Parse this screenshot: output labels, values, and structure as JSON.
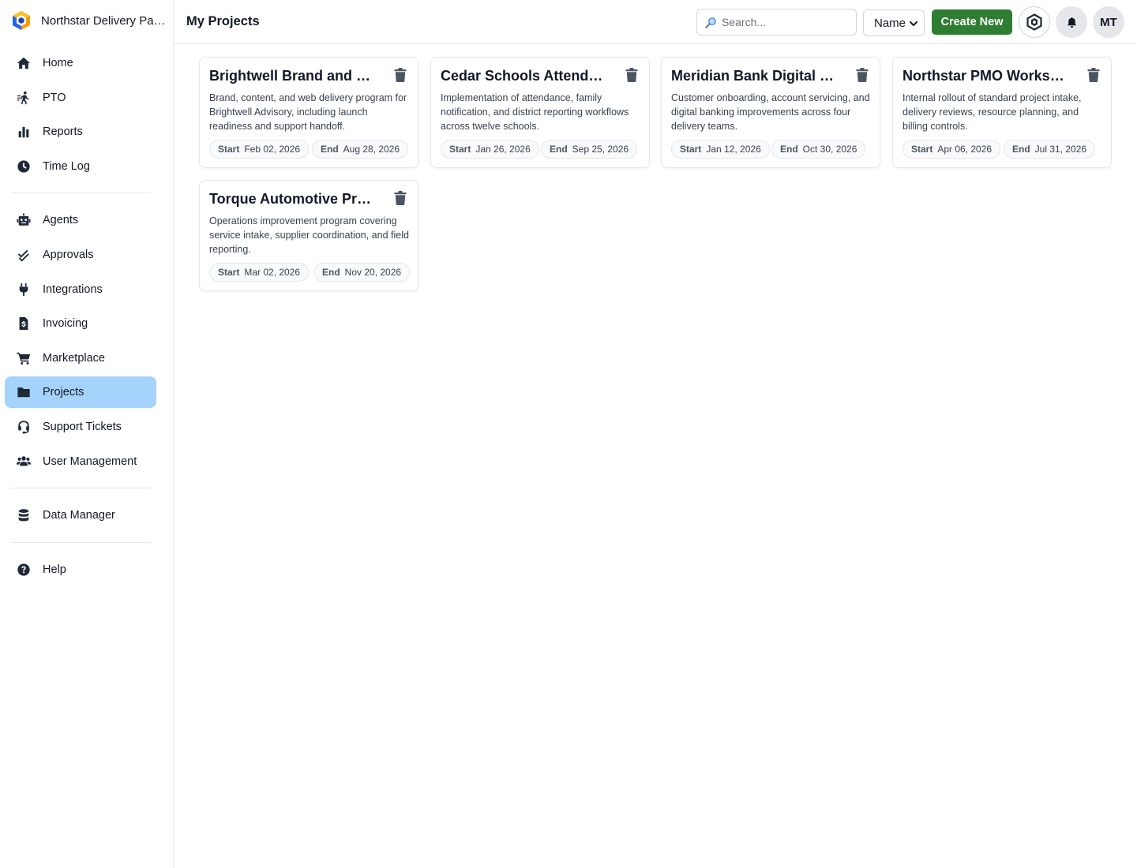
{
  "sidebar": {
    "org_name": "Northstar Delivery Partners",
    "items": [
      {
        "label": "Home",
        "icon": "home-icon"
      },
      {
        "label": "PTO",
        "icon": "walking-icon"
      },
      {
        "label": "Reports",
        "icon": "bar-chart-icon"
      },
      {
        "label": "Time Log",
        "icon": "clock-icon"
      },
      {
        "label": "Agents",
        "icon": "robot-icon"
      },
      {
        "label": "Approvals",
        "icon": "double-check-icon"
      },
      {
        "label": "Integrations",
        "icon": "plug-icon"
      },
      {
        "label": "Invoicing",
        "icon": "invoice-icon"
      },
      {
        "label": "Marketplace",
        "icon": "cart-icon"
      },
      {
        "label": "Projects",
        "icon": "folder-icon",
        "active": true
      },
      {
        "label": "Support Tickets",
        "icon": "headset-icon"
      },
      {
        "label": "User Management",
        "icon": "users-icon"
      },
      {
        "label": "Data Manager",
        "icon": "database-icon"
      },
      {
        "label": "Help",
        "icon": "question-icon"
      }
    ]
  },
  "header": {
    "title": "My Projects",
    "search_placeholder": "Search...",
    "sort_value": "Name",
    "create_label": "Create New",
    "avatar_initials": "MT"
  },
  "projects": [
    {
      "title": "Brightwell Brand and Web Launch",
      "description": "Brand, content, and web delivery program for Brightwell Advisory, including launch readiness and support handoff.",
      "start_label": "Start",
      "start": "Feb 02, 2026",
      "end_label": "End",
      "end": "Aug 28, 2026"
    },
    {
      "title": "Cedar Schools Attendance Platform",
      "description": "Implementation of attendance, family notification, and district reporting workflows across twelve schools.",
      "start_label": "Start",
      "start": "Jan 26, 2026",
      "end_label": "End",
      "end": "Sep 25, 2026"
    },
    {
      "title": "Meridian Bank Digital Onboarding",
      "description": "Customer onboarding, account servicing, and digital banking improvements across four delivery teams.",
      "start_label": "Start",
      "start": "Jan 12, 2026",
      "end_label": "End",
      "end": "Oct 30, 2026"
    },
    {
      "title": "Northstar PMO Workspace Rollout",
      "description": "Internal rollout of standard project intake, delivery reviews, resource planning, and billing controls.",
      "start_label": "Start",
      "start": "Apr 06, 2026",
      "end_label": "End",
      "end": "Jul 31, 2026"
    },
    {
      "title": "Torque Automotive Process Program",
      "description": "Operations improvement program covering service intake, supplier coordination, and field reporting.",
      "start_label": "Start",
      "start": "Mar 02, 2026",
      "end_label": "End",
      "end": "Nov 20, 2026"
    }
  ],
  "colors": {
    "accent": "#2e7d32",
    "active_nav": "#a6d3fb",
    "border": "#e5e7eb"
  }
}
